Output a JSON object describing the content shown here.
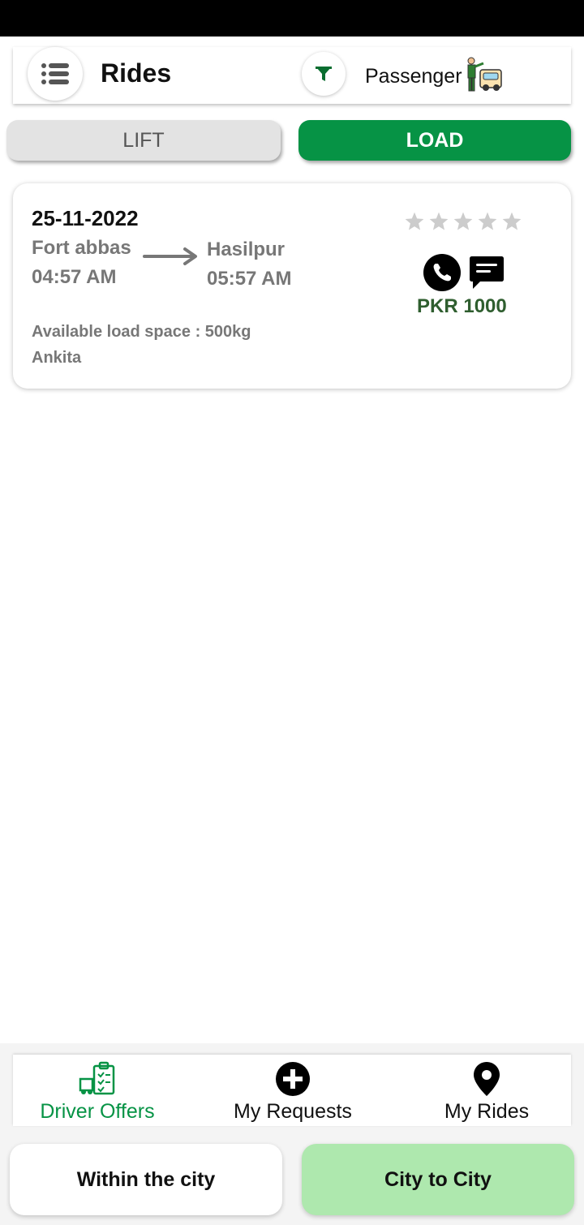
{
  "header": {
    "title": "Rides",
    "role_label": "Passenger",
    "menu_icon": "list-menu-icon",
    "filter_icon": "filter-icon"
  },
  "tabs": [
    {
      "label": "LIFT",
      "active": false
    },
    {
      "label": "LOAD",
      "active": true
    }
  ],
  "ride": {
    "date": "25-11-2022",
    "from": "Fort abbas",
    "from_time": "04:57 AM",
    "to": "Hasilpur",
    "to_time": "05:57 AM",
    "load_space": "Available load space : 500kg",
    "driver": "Ankita",
    "rating": 0,
    "rating_max": 5,
    "price": "PKR 1000"
  },
  "bottom_nav": {
    "items": [
      {
        "label": "Driver Offers",
        "icon": "driver-offers-icon",
        "active": true
      },
      {
        "label": "My Requests",
        "icon": "plus-circle-icon",
        "active": false
      },
      {
        "label": "My Rides",
        "icon": "location-pin-icon",
        "active": false
      }
    ]
  },
  "modes": {
    "within": "Within the city",
    "city": "City to City"
  },
  "colors": {
    "accent": "#069345",
    "price": "#2f5e2f",
    "city_button": "#aee8ae",
    "star_empty": "#cccccc"
  }
}
